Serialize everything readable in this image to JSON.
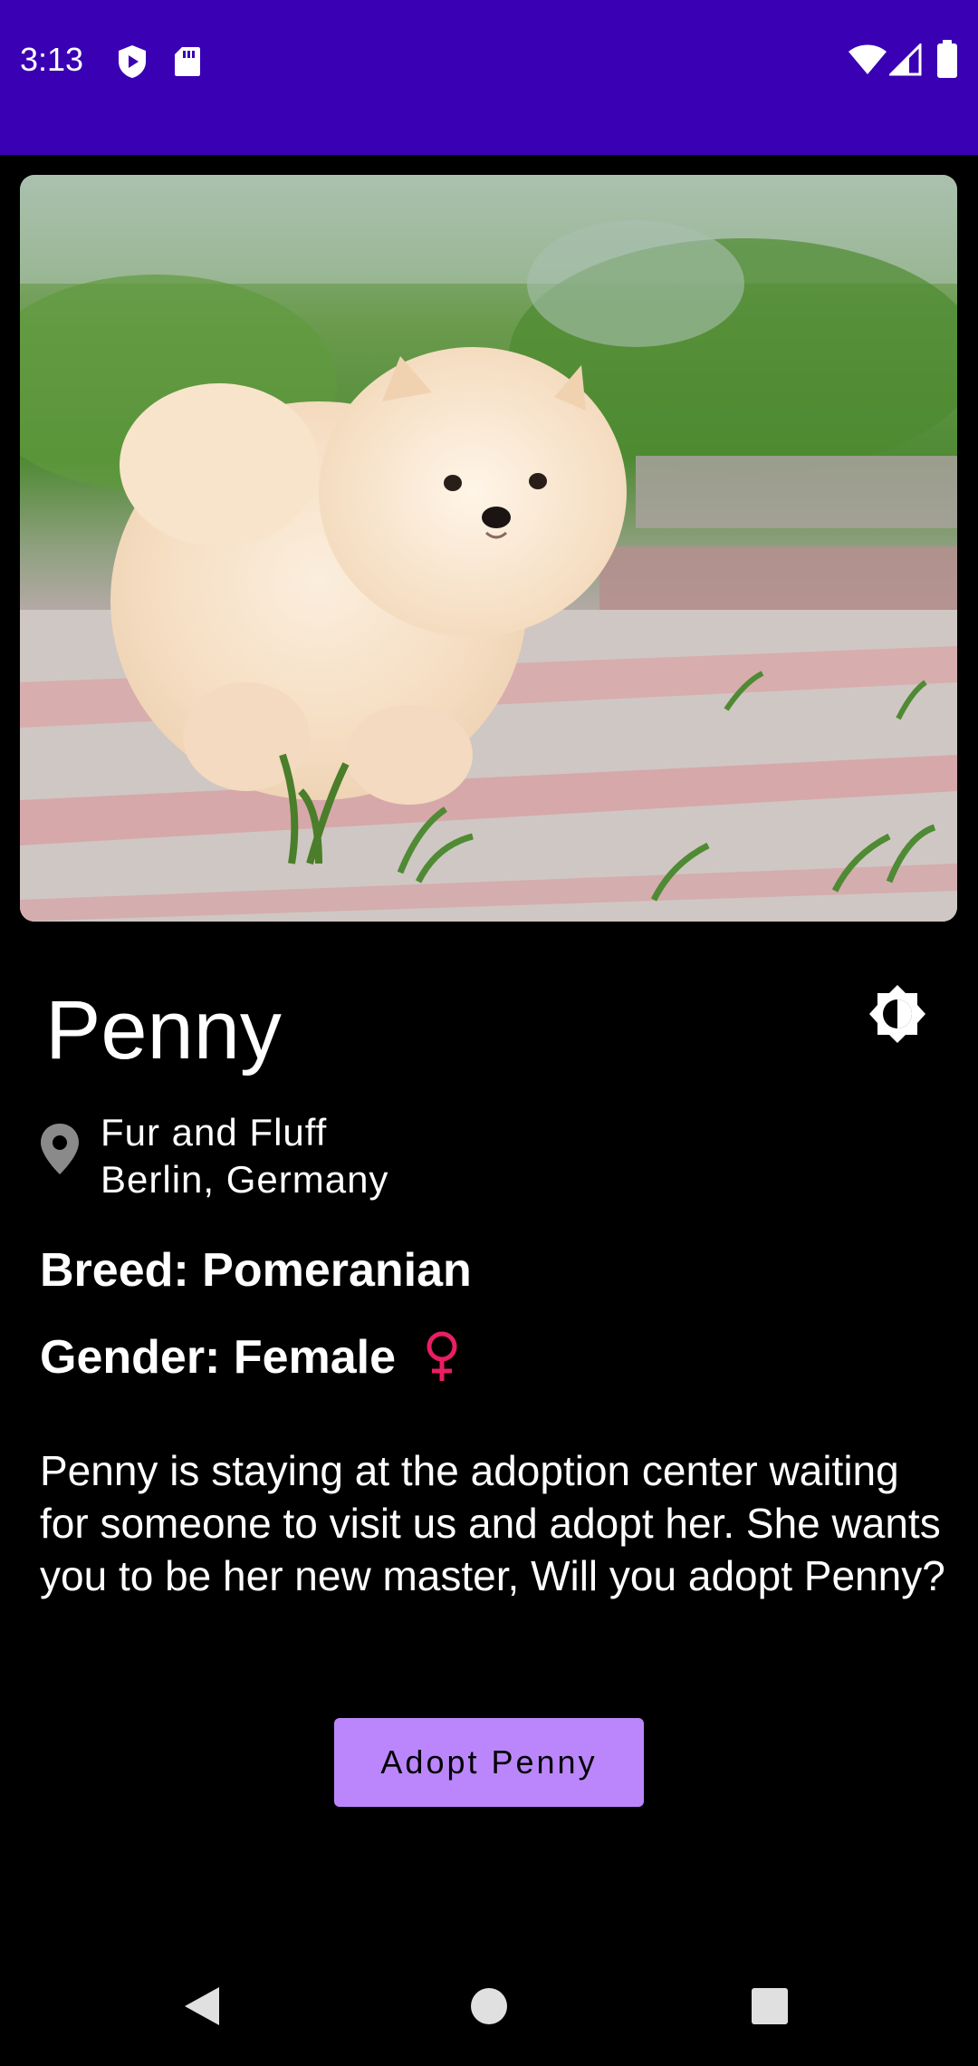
{
  "status_bar": {
    "time": "3:13",
    "background_color": "#3a00b3",
    "icons": [
      "shield-play-icon",
      "sd-card-icon",
      "wifi-icon",
      "cellular-signal-icon",
      "battery-icon"
    ]
  },
  "hero": {
    "image_description_icon": "pomeranian-puppy-photo"
  },
  "pet": {
    "name": "Penny",
    "location_line1": "Fur and Fluff",
    "location_line2": "Berlin, Germany",
    "breed": "Breed: Pomeranian",
    "gender": "Gender: Female",
    "gender_symbol": "♀",
    "gender_color": "#e91e63",
    "description": "Penny is staying at the adoption center waiting for someone to visit us and adopt her. She wants you to be her new master, Will you adopt Penny?"
  },
  "actions": {
    "adopt_label": "Adopt Penny",
    "accent_color": "#bb86fc"
  },
  "nav_bar": {
    "icons": [
      "back-icon",
      "home-icon",
      "recents-icon"
    ]
  }
}
